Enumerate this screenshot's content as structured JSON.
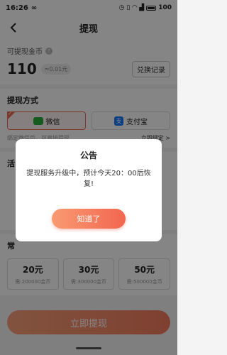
{
  "status_bar": {
    "time": "16:26",
    "time_suffix": "∞",
    "battery": "100"
  },
  "nav": {
    "title": "提现"
  },
  "balance": {
    "label": "可提现金币",
    "amount": "110",
    "approx": "≈0.01元",
    "exchange_label": "兑换记录"
  },
  "method": {
    "title": "提现方式",
    "options": [
      {
        "label": "微信",
        "selected": true
      },
      {
        "label": "支付宝",
        "selected": false
      }
    ],
    "note": "绑定微信后，可直接提现",
    "bind_link": "立即绑定 >"
  },
  "activity": {
    "title": "活"
  },
  "common": {
    "title": "常",
    "amounts": [
      {
        "value": "20元",
        "coins": "需:200000金币"
      },
      {
        "value": "30元",
        "coins": "需:300000金币"
      },
      {
        "value": "50元",
        "coins": "需:500000金币"
      }
    ]
  },
  "submit": {
    "label": "立即提现"
  },
  "dialog": {
    "title": "公告",
    "body": "提现服务升级中，预计今天20：00后恢复!",
    "button": "知道了"
  },
  "colors": {
    "accent": "#f06a4f",
    "wechat": "#2aae3c",
    "alipay": "#1677ff"
  }
}
